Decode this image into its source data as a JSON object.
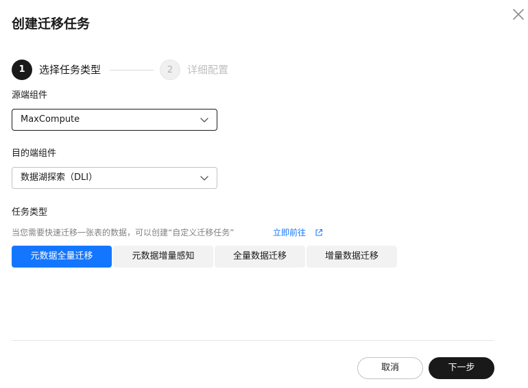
{
  "dialog": {
    "title": "创建迁移任务"
  },
  "steps": [
    {
      "number": "1",
      "label": "选择任务类型",
      "state": "active"
    },
    {
      "number": "2",
      "label": "详细配置",
      "state": "inactive"
    }
  ],
  "form": {
    "source": {
      "label": "源端组件",
      "value": "MaxCompute"
    },
    "target": {
      "label": "目的端组件",
      "value": "数据湖探索（DLI）"
    },
    "task_type": {
      "label": "任务类型",
      "hint": "当您需要快速迁移一张表的数据，可以创建“自定义迁移任务”",
      "hint_link": "立即前往",
      "options": [
        {
          "label": "元数据全量迁移",
          "selected": true
        },
        {
          "label": "元数据增量感知",
          "selected": false
        },
        {
          "label": "全量数据迁移",
          "selected": false
        },
        {
          "label": "增量数据迁移",
          "selected": false
        }
      ]
    }
  },
  "footer": {
    "cancel_label": "取消",
    "next_label": "下一步"
  },
  "colors": {
    "primary": "#191919",
    "accent": "#1476ff",
    "tab_inactive": "#f2f2f2"
  }
}
